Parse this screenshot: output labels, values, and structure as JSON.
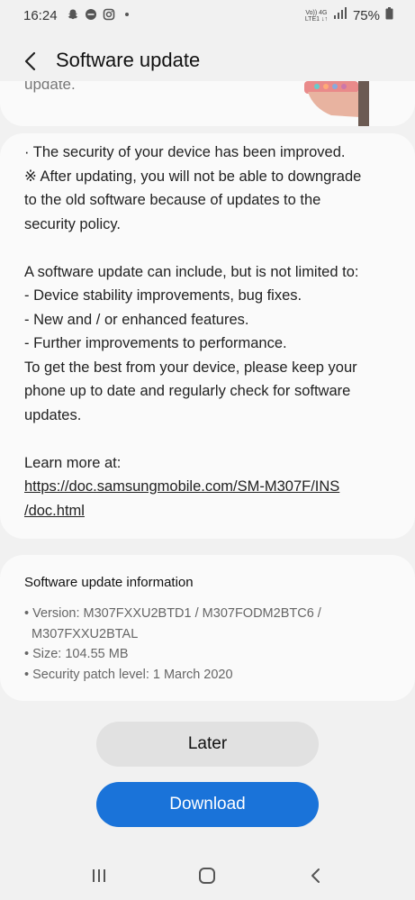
{
  "status_bar": {
    "time": "16:24",
    "net_top": "Vo)) 4G",
    "net_bottom": "LTE1 ↓↑",
    "battery": "75%"
  },
  "header": {
    "title": "Software update"
  },
  "card_top": {
    "fragment": "update."
  },
  "body": {
    "line1": "· The security of your device has been improved.",
    "line2": "※ After updating, you will not be able to downgrade",
    "line3": "to the old software because of updates to the",
    "line4": "security policy.",
    "line5": "A software update can include, but is not limited to:",
    "line6": " - Device stability improvements, bug fixes.",
    "line7": " - New and / or enhanced features.",
    "line8": " - Further improvements to performance.",
    "line9": "To get the best from your device, please keep your",
    "line10": "phone up to date and regularly check for software",
    "line11": "updates.",
    "learn_more": "Learn more at:",
    "link_line1": "https://doc.samsungmobile.com/SM-M307F/INS",
    "link_line2": "/doc.html"
  },
  "info": {
    "title": "Software update information",
    "version_line1": "• Version: M307FXXU2BTD1 / M307FODM2BTC6 /",
    "version_line2": "  M307FXXU2BTAL",
    "size": "• Size: 104.55 MB",
    "patch": "• Security patch level: 1 March 2020"
  },
  "buttons": {
    "later": "Later",
    "download": "Download"
  },
  "colors": {
    "accent": "#1a73d9",
    "background": "#f1f1f1",
    "card": "#fafafa"
  },
  "icons": [
    "snapchat-icon",
    "dnd-icon",
    "instagram-icon",
    "signal-icon",
    "battery-icon",
    "back-arrow-icon",
    "recents-icon",
    "home-icon",
    "nav-back-icon"
  ]
}
